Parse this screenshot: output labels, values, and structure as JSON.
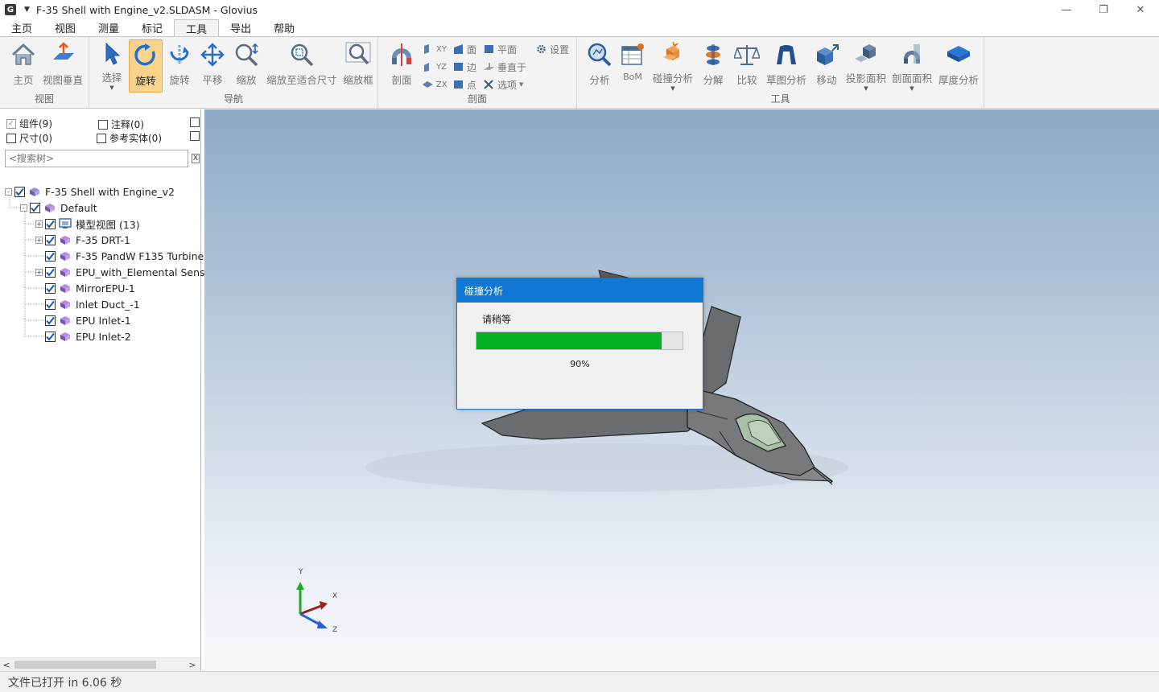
{
  "window": {
    "app_icon": "G",
    "title": "F-35 Shell with Engine_v2.SLDASM - Glovius",
    "minimize": "—",
    "restore": "❐",
    "close": "✕"
  },
  "menu": [
    "主页",
    "视图",
    "测量",
    "标记",
    "工具",
    "导出",
    "帮助"
  ],
  "menu_active": "工具",
  "ribbon": {
    "view_group": {
      "label": "视图",
      "buttons": [
        "主页",
        "视图垂直"
      ]
    },
    "nav_group": {
      "label": "导航",
      "buttons": [
        "选择",
        "旋转",
        "旋转",
        "平移",
        "缩放",
        "缩放至适合尺寸",
        "缩放框"
      ],
      "active": "旋转"
    },
    "section_group": {
      "label": "剖面",
      "big_button": "剖面",
      "axes": [
        "XY",
        "YZ",
        "ZX"
      ],
      "entities": [
        "面",
        "边",
        "点"
      ],
      "options": [
        "平面",
        "垂直于",
        "选项"
      ],
      "settings": "设置"
    },
    "tools_group": {
      "label": "工具",
      "buttons": [
        "分析",
        "BoM",
        "碰撞分析",
        "分解",
        "比较",
        "草图分析",
        "移动",
        "投影面积",
        "剖面面积",
        "厚度分析"
      ]
    }
  },
  "panel": {
    "filters": [
      {
        "label": "组件(9)",
        "checked": true
      },
      {
        "label": "注释(0)",
        "checked": false
      },
      {
        "label": "尺寸(0)",
        "checked": false
      },
      {
        "label": "参考实体(0)",
        "checked": false
      }
    ],
    "search_placeholder": "<搜索树>",
    "search_clear": "X",
    "tree": [
      {
        "label": "F-35 Shell with Engine_v2",
        "level": 0,
        "expander": "-",
        "icon": "assembly-icon"
      },
      {
        "label": "Default",
        "level": 1,
        "expander": "-",
        "icon": "config-icon"
      },
      {
        "label": "模型视图 (13)",
        "level": 2,
        "expander": "+",
        "icon": "model-view-icon"
      },
      {
        "label": "F-35 DRT-1",
        "level": 2,
        "expander": "+",
        "icon": "part-icon"
      },
      {
        "label": "F-35 PandW F135 Turbine",
        "level": 2,
        "expander": "",
        "icon": "part-icon"
      },
      {
        "label": "EPU_with_Elemental Senso",
        "level": 2,
        "expander": "+",
        "icon": "part-icon"
      },
      {
        "label": "MirrorEPU-1",
        "level": 2,
        "expander": "",
        "icon": "part-icon"
      },
      {
        "label": "Inlet Duct_-1",
        "level": 2,
        "expander": "",
        "icon": "part-icon"
      },
      {
        "label": "EPU Inlet-1",
        "level": 2,
        "expander": "",
        "icon": "part-icon"
      },
      {
        "label": "EPU Inlet-2",
        "level": 2,
        "expander": "",
        "icon": "part-icon"
      }
    ]
  },
  "axes_triad": {
    "x": "X",
    "y": "Y",
    "z": "Z"
  },
  "dialog": {
    "title": "碰撞分析",
    "message": "请稍等",
    "progress": 0.9,
    "percent_text": "90%"
  },
  "status": "文件已打开 in 6.06 秒"
}
